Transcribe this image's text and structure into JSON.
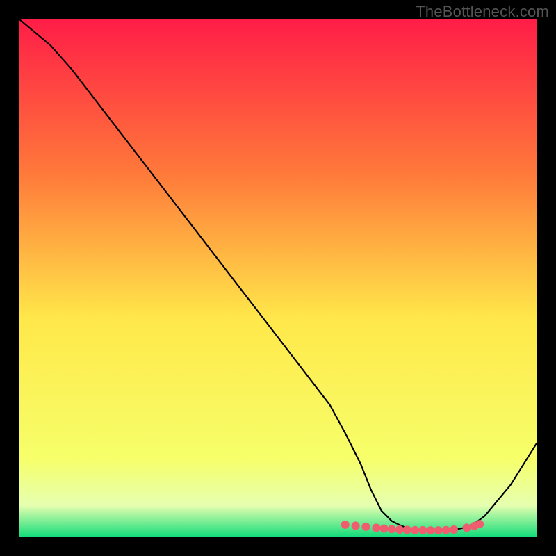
{
  "watermark": "TheBottleneck.com",
  "chart_data": {
    "type": "line",
    "title": "",
    "xlabel": "",
    "ylabel": "",
    "xlim": [
      0,
      100
    ],
    "ylim": [
      0,
      100
    ],
    "x": [
      0,
      6,
      10,
      15,
      20,
      25,
      30,
      35,
      40,
      45,
      50,
      55,
      60,
      63,
      66,
      68,
      70,
      72,
      74,
      76,
      78,
      80,
      82,
      84,
      86,
      88,
      90,
      95,
      100
    ],
    "y": [
      100,
      95,
      90.5,
      84,
      77.5,
      71,
      64.5,
      58,
      51.5,
      45,
      38.5,
      32,
      25.5,
      20,
      14,
      9,
      5,
      3,
      2,
      1.5,
      1.2,
      1.1,
      1.1,
      1.3,
      1.7,
      2.5,
      4,
      10,
      18
    ],
    "markers_x": [
      63,
      65,
      67,
      69,
      70.5,
      72,
      73.5,
      75,
      76.5,
      78,
      79.5,
      81,
      82.5,
      84,
      86.5,
      88,
      89
    ],
    "markers_y": [
      2.3,
      2.1,
      1.9,
      1.7,
      1.55,
      1.45,
      1.35,
      1.3,
      1.25,
      1.22,
      1.2,
      1.2,
      1.25,
      1.35,
      1.7,
      2.05,
      2.4
    ],
    "colors": {
      "gradient_top": "#ff1d47",
      "gradient_upper": "#ff7a3a",
      "gradient_middle": "#ffe84a",
      "gradient_lower_yellow": "#f6ff6a",
      "gradient_lower": "#e6ffb0",
      "gradient_bottom": "#15dd7b",
      "curve_stroke": "#000000",
      "marker_fill": "#ef5d6f"
    },
    "legend": [],
    "grid": false,
    "annotations": []
  }
}
